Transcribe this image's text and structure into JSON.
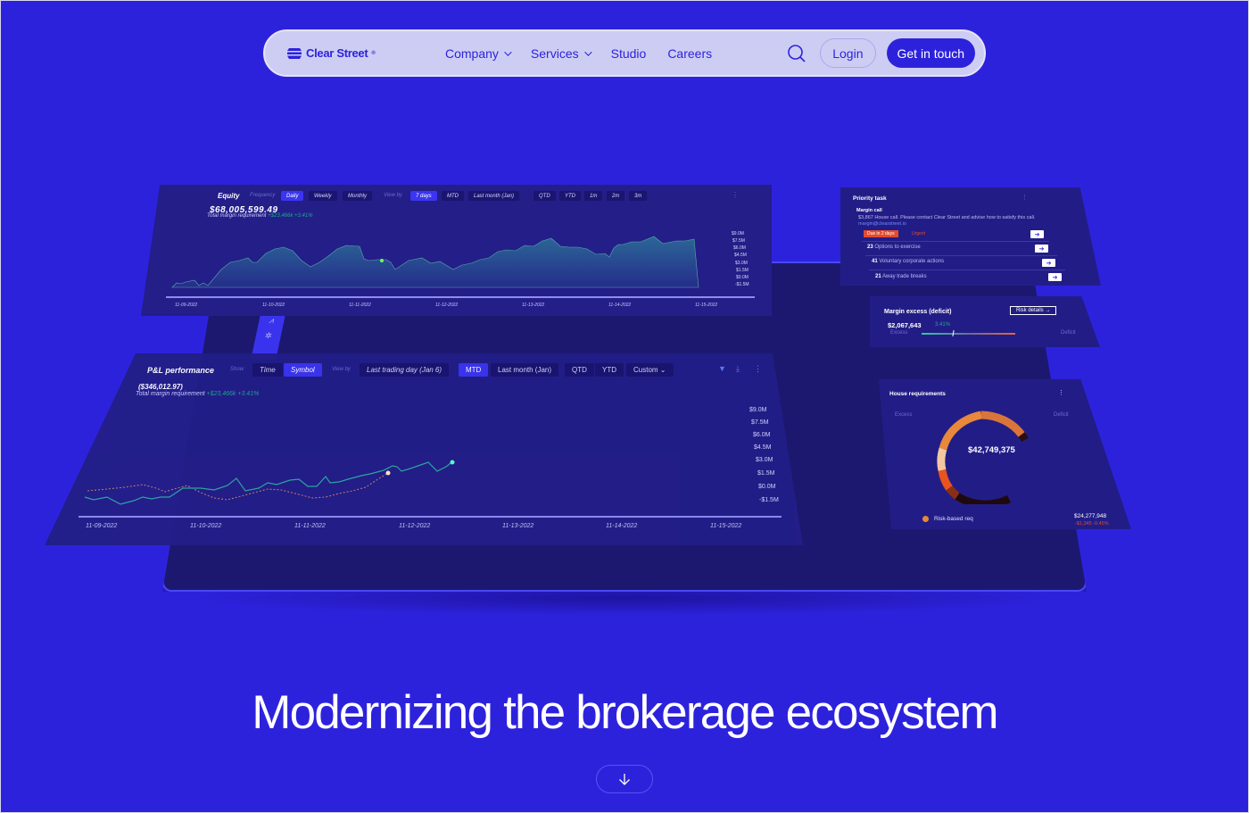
{
  "nav": {
    "brand": "Clear Street",
    "brand_mark": "®",
    "links": [
      {
        "label": "Company",
        "has_dropdown": true
      },
      {
        "label": "Services",
        "has_dropdown": true
      },
      {
        "label": "Studio",
        "has_dropdown": false
      },
      {
        "label": "Careers",
        "has_dropdown": false
      }
    ],
    "search_icon": "search-icon",
    "login_label": "Login",
    "cta_label": "Get in touch"
  },
  "equity": {
    "title": "Equity",
    "frequency_label": "Frequency",
    "frequency_options": [
      "Daily",
      "Weekly",
      "Monthly"
    ],
    "frequency_selected": "Daily",
    "viewby_label": "View by",
    "viewby_options": [
      "7 days",
      "MTD",
      "Last month (Jan)",
      "QTD",
      "YTD",
      "1m",
      "2m",
      "3m"
    ],
    "viewby_selected": "7 days",
    "value": "$68,005,599.49",
    "sub_label": "Total margin requirement",
    "sub_change": "+$23,466k",
    "sub_pct": "+3.41%",
    "y_ticks": [
      "$9.0M",
      "$7.5M",
      "$6.0M",
      "$4.5M",
      "$3.0M",
      "$1.5M",
      "$0.0M",
      "-$1.5M"
    ],
    "x_ticks": [
      "11-09-2022",
      "11-10-2022",
      "11-11-2022",
      "11-12-2022",
      "11-13-2022",
      "11-14-2022",
      "11-15-2022"
    ]
  },
  "pnl": {
    "title": "P&L performance",
    "show_label": "Show",
    "show_options": [
      "Time",
      "Symbol"
    ],
    "show_selected": "Symbol",
    "viewby_label": "View by",
    "viewby_options": [
      "Last trading day (Jan 6)",
      "MTD",
      "Last month (Jan)",
      "QTD",
      "YTD",
      "Custom"
    ],
    "viewby_selected": "MTD",
    "value": "($346,012.97)",
    "sub_label": "Total margin requirement",
    "sub_change": "+$23,466k",
    "sub_pct": "+3.41%",
    "y_ticks": [
      "$9.0M",
      "$7.5M",
      "$6.0M",
      "$4.5M",
      "$3.0M",
      "$1.5M",
      "$0.0M",
      "-$1.5M"
    ],
    "x_ticks": [
      "11-09-2022",
      "11-10-2022",
      "11-11-2022",
      "11-12-2022",
      "11-13-2022",
      "11-14-2022",
      "11-15-2022"
    ]
  },
  "priority": {
    "title": "Priority task",
    "alert_title": "Margin call",
    "alert_text": "$3,867 House call. Please contact Clear Street and advise how to satisfy this call.",
    "alert_email": "margin@clearstreet.io",
    "due_badge": "Due in 2 days",
    "urgency": "Urgent",
    "tasks": [
      {
        "count": "23",
        "label": "Options to exercise"
      },
      {
        "count": "41",
        "label": "Voluntary corporate actions"
      },
      {
        "count": "21",
        "label": "Away trade breaks"
      }
    ]
  },
  "margin": {
    "title": "Margin excess (deficit)",
    "button": "Risk details",
    "value": "$2,067,643",
    "pct": "3.41%",
    "left_label": "Excess",
    "right_label": "Deficit"
  },
  "house": {
    "title": "House requirements",
    "left_label": "Excess",
    "right_label": "Deficit",
    "center_value": "$42,749,375",
    "legend": "Risk-based req",
    "deficit_value": "$24,277,948",
    "deficit_change": "-$1,345",
    "deficit_pct": "-0.45%"
  },
  "hero": {
    "headline": "Modernizing the brokerage ecosystem",
    "scroll_icon": "arrow-down-icon"
  },
  "colors": {
    "background": "#2d22dc",
    "nav_bg": "#cdcdf4",
    "accent": "#2d22dc",
    "panel": "#231e88",
    "positive": "#1fa98a",
    "negative": "#e24b2e",
    "orange": "#e8883a"
  }
}
